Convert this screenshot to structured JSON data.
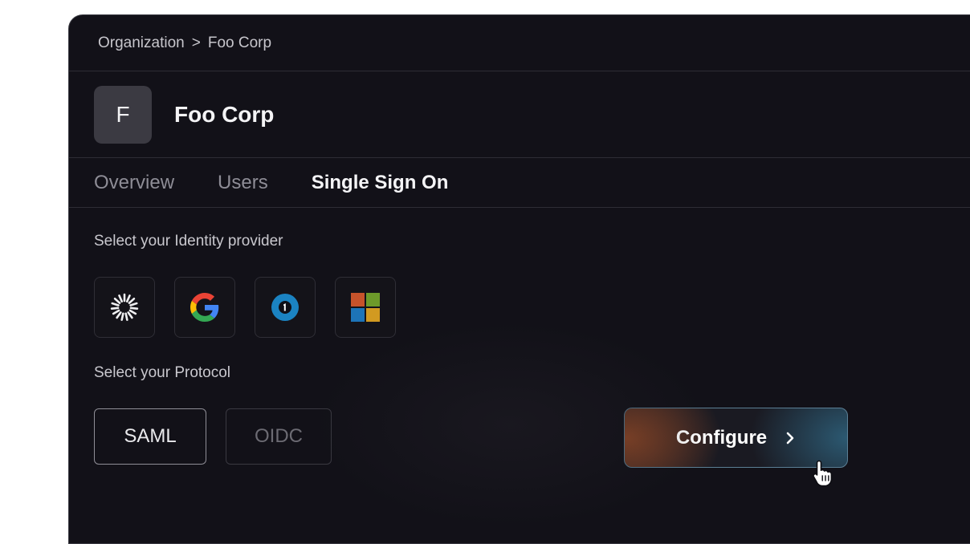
{
  "breadcrumb": {
    "root": "Organization",
    "separator": ">",
    "current": "Foo Corp"
  },
  "org": {
    "avatar_letter": "F",
    "name": "Foo Corp"
  },
  "tabs": [
    {
      "label": "Overview",
      "active": false
    },
    {
      "label": "Users",
      "active": false
    },
    {
      "label": "Single Sign On",
      "active": true
    }
  ],
  "identity_provider": {
    "label": "Select your Identity provider",
    "providers": [
      {
        "icon": "okta-icon"
      },
      {
        "icon": "google-icon"
      },
      {
        "icon": "onelogin-icon"
      },
      {
        "icon": "microsoft-icon"
      }
    ]
  },
  "protocol": {
    "label": "Select your Protocol",
    "options": [
      "SAML",
      "OIDC"
    ],
    "selected": "SAML"
  },
  "configure_button": {
    "label": "Configure"
  },
  "colors": {
    "panel_bg": "#121118",
    "accent_orange": "#be5a28",
    "accent_blue": "#326e8c"
  }
}
